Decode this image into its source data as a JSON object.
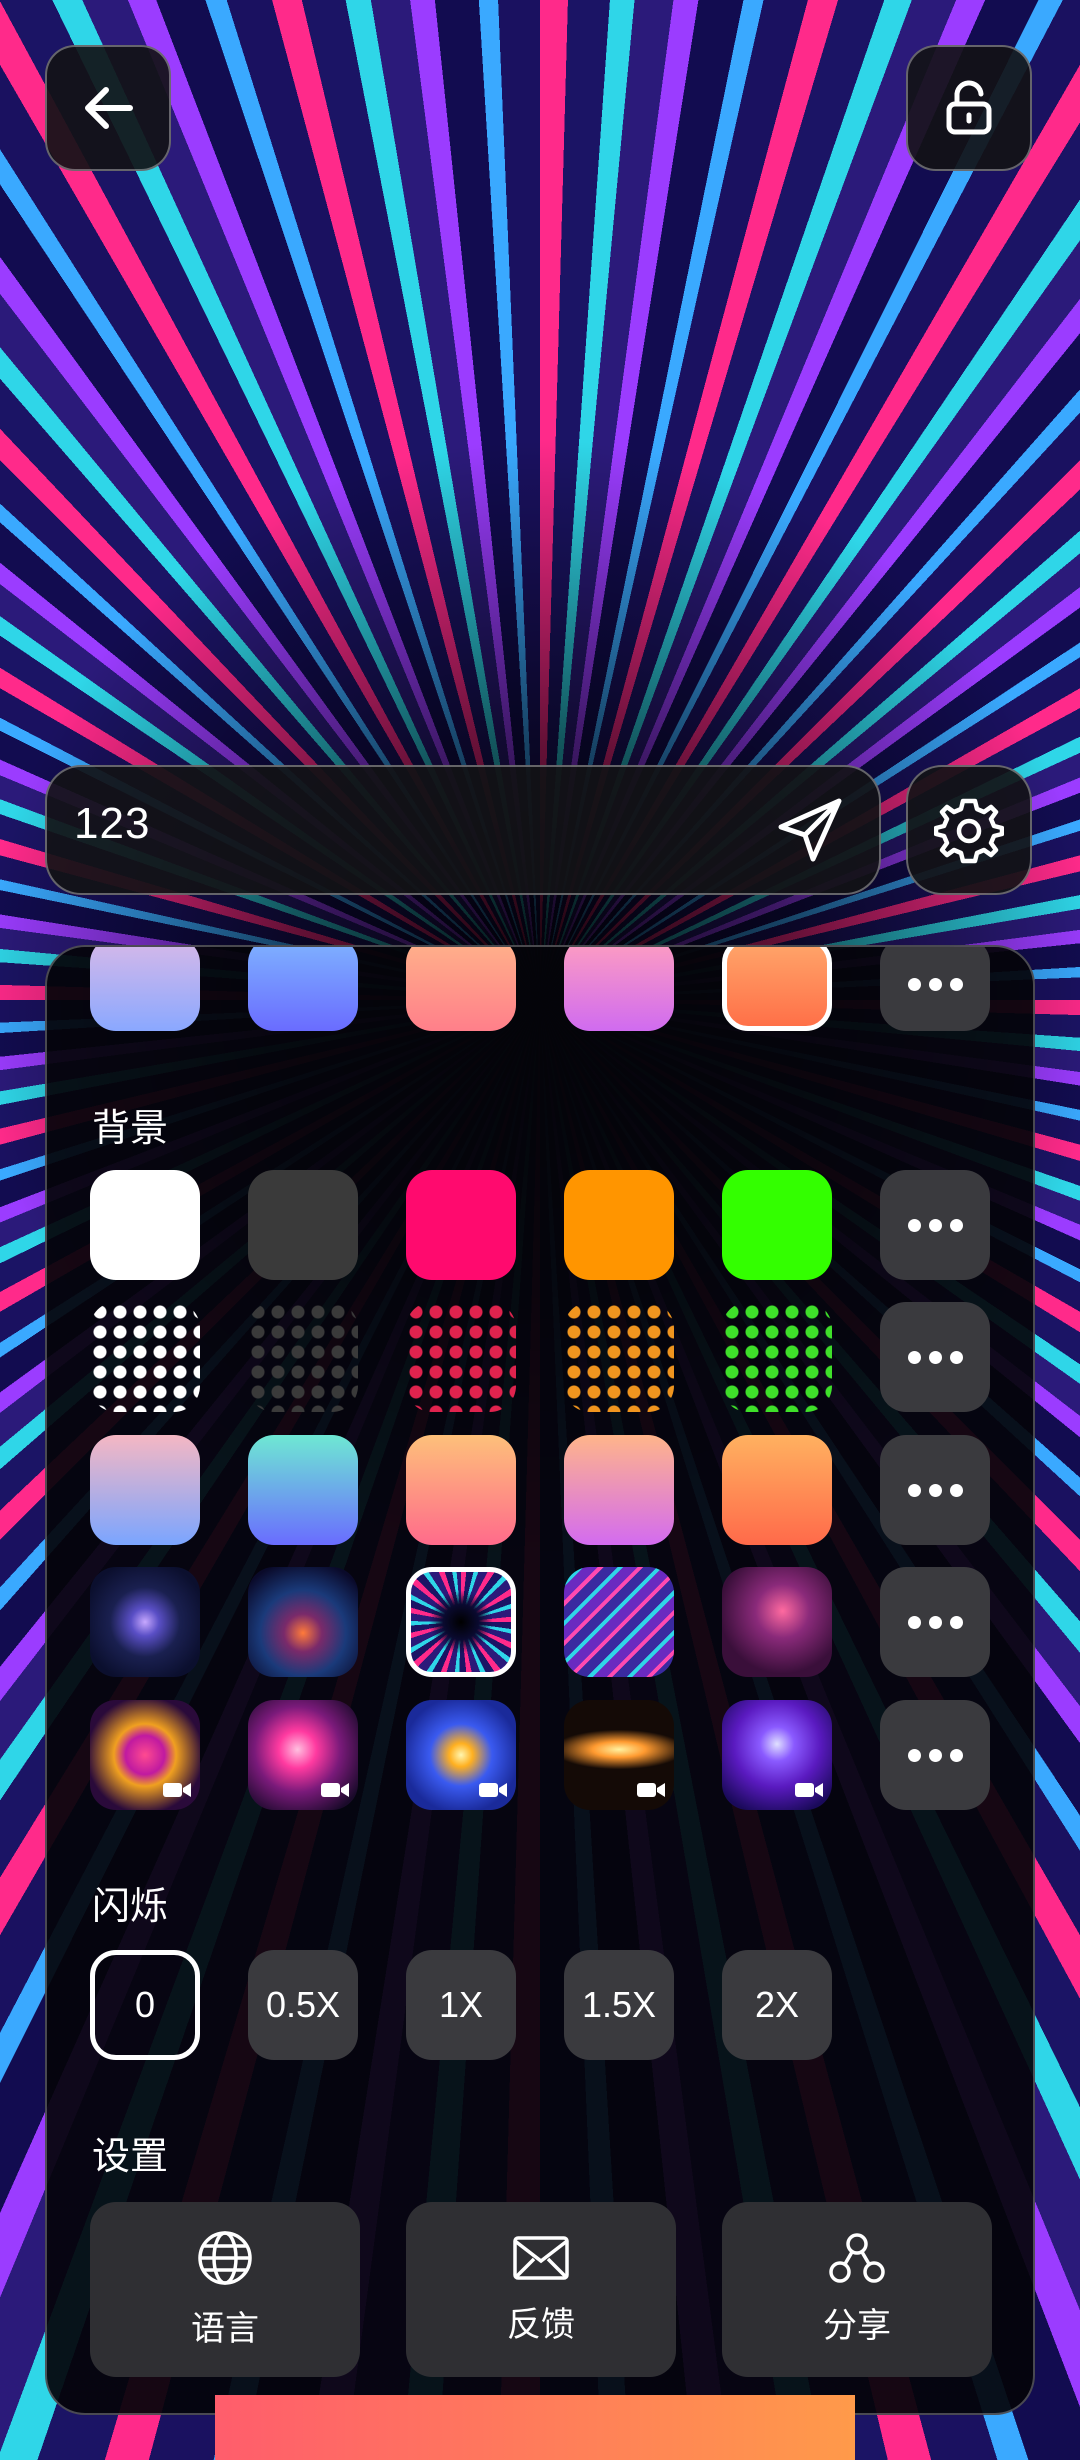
{
  "input": {
    "value": "123"
  },
  "icons": {
    "back": "arrow-left-icon",
    "lock": "unlock-icon",
    "send": "send-icon",
    "settings": "gear-icon",
    "more": "more-dots-icon",
    "video": "video-camera-icon",
    "language": "globe-icon",
    "feedback": "mail-icon",
    "share": "share-icon"
  },
  "text_colors_partial_row": [
    "#b7b9f3",
    "#6d7cf9",
    "#ff9f88",
    "#d77ee9",
    "#ff8a5b"
  ],
  "background": {
    "title": "背景",
    "solid": [
      "#ffffff",
      "#3a3a3a",
      "#ff0a6e",
      "#ff9500",
      "#33ff00"
    ],
    "dotted": [
      "#ffffff",
      "#3a3a3a",
      "#e0234e",
      "#f0951f",
      "#3fe02a"
    ],
    "gradients": [
      [
        "#f5b7c3",
        "#7aa5ff"
      ],
      [
        "#6ee8d3",
        "#6a6cff"
      ],
      [
        "#fdc07a",
        "#ff6b8b"
      ],
      [
        "#ffb58a",
        "#d36bf0"
      ],
      [
        "#ffb160",
        "#ff6a4a"
      ]
    ],
    "thumbnails_selected_index": 2
  },
  "flash": {
    "title": "闪烁",
    "options": [
      "0",
      "0.5X",
      "1X",
      "1.5X",
      "2X"
    ],
    "selected_index": 0
  },
  "settings": {
    "title": "设置",
    "language": "语言",
    "feedback": "反馈",
    "share": "分享"
  }
}
